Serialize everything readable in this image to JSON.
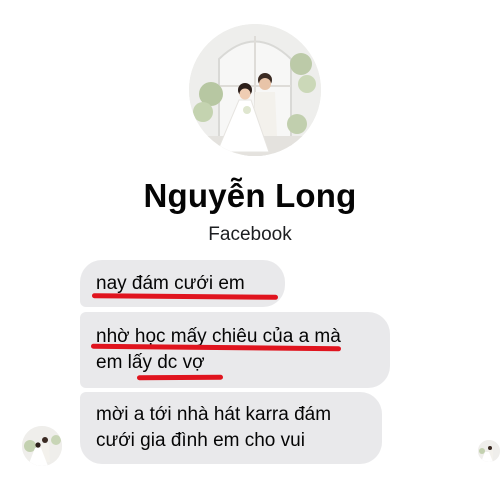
{
  "profile": {
    "name": "Nguyễn Long",
    "subtitle": "Facebook",
    "photo": "wedding-couple-photo"
  },
  "messages": [
    {
      "lines": [
        "nay đám cưới em"
      ]
    },
    {
      "lines": [
        "nhờ học mấy chiêu của a mà",
        "em lấy dc vợ"
      ]
    },
    {
      "lines": [
        "mời a tới nhà hát karra đám",
        "cưới gia đình em cho vui"
      ]
    }
  ],
  "colors": {
    "bubble": "#e9e9eb",
    "underline": "#e0141e",
    "text": "#050505"
  }
}
